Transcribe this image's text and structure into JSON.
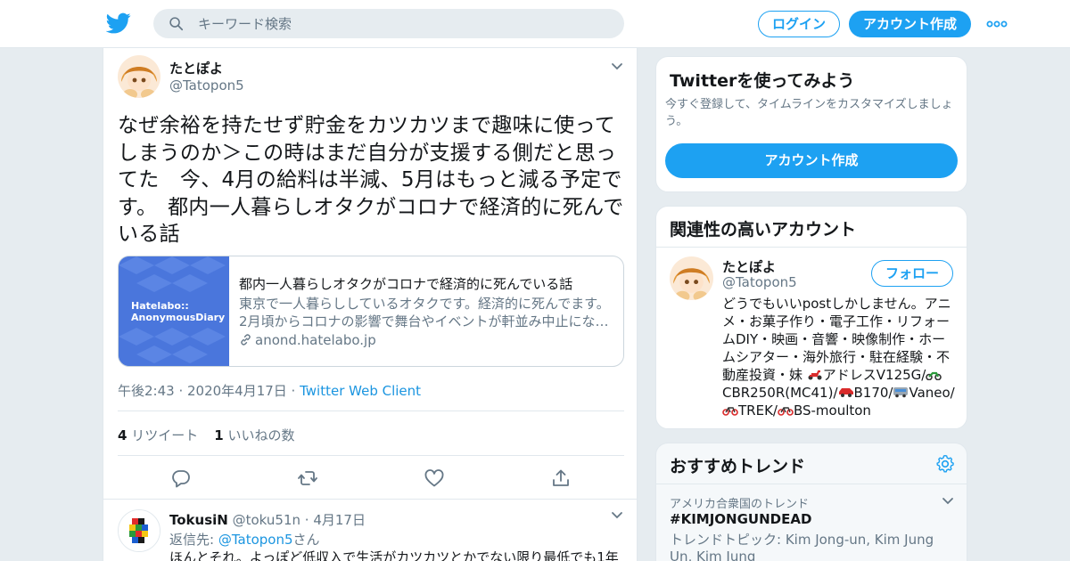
{
  "header": {
    "search_placeholder": "キーワード検索",
    "login_label": "ログイン",
    "signup_label": "アカウント作成"
  },
  "tweet": {
    "name": "たとぽよ",
    "handle": "@Tatopon5",
    "text": "なぜ余裕を持たせず貯金をカツカツまで趣味に使ってしまうのか＞この時はまだ自分が支援する側だと思ってた　今、4月の給料は半減、5月はもっと減る予定です。　都内一人暮らしオタクがコロナで経済的に死んでいる話",
    "card": {
      "image_text_1": "Hatelabo::",
      "image_text_2": "AnonymousDiary",
      "title": "都内一人暮らしオタクがコロナで経済的に死んでいる話",
      "desc_line1": "東京で一人暮らししているオタクです。経済的に死んでます。",
      "desc_line2": "2月頃からコロナの影響で舞台やイベントが軒並み中止にな…",
      "domain": "anond.hatelabo.jp"
    },
    "meta_time": "午後2:43 · 2020年4月17日 · ",
    "meta_source": "Twitter Web Client",
    "retweet_count": "4",
    "retweet_label": "リツイート",
    "like_count": "1",
    "like_label": "いいねの数"
  },
  "reply": {
    "name": "TokusiN",
    "handle": "@toku51n",
    "date": "· 4月17日",
    "replying_to_prefix": "返信先: ",
    "replying_to_handle": "@Tatopon5",
    "replying_to_suffix": "さん",
    "text": "ほんとそれ。よっぽど低収入で生活がカツカツとかでない限り最低でも1年"
  },
  "sidebar": {
    "signup_box": {
      "title": "Twitterを使ってみよう",
      "subtitle": "今すぐ登録して、タイムラインをカスタマイズしましょう。",
      "button_label": "アカウント作成"
    },
    "related": {
      "title": "関連性の高いアカウント",
      "name": "たとぽよ",
      "handle": "@Tatopon5",
      "follow_label": "フォロー",
      "bio_1": "どうでもいいpostしかしません。アニメ・お菓子作り・電子工作・リフォームDIY・映画・音響・映像制作・ホームシアター・海外旅行・駐在経験・不動産投資・妹 ",
      "bio_2": "アドレスV125G/",
      "bio_3": "CBR250R(MC41)/",
      "bio_4": "B170/",
      "bio_5": "Vaneo/",
      "bio_6": "TREK/",
      "bio_7": "BS-moulton"
    },
    "trends": {
      "title": "おすすめトレンド",
      "category": "アメリカ合衆国のトレンド",
      "name": "#KIMJONGUNDEAD",
      "topics": "トレンドトピック: Kim Jong-un, Kim Jung Un, Kim Jung"
    }
  },
  "colors": {
    "accent": "#1da1f2",
    "link": "#1b95e0",
    "secondary_text": "#657786",
    "border": "#e1e8ed",
    "page_bg": "#e6ecf0"
  },
  "icons": [
    "twitter-bird-icon",
    "search-icon",
    "more-icon",
    "chevron-down-icon",
    "link-icon",
    "reply-icon",
    "retweet-icon",
    "like-icon",
    "share-icon",
    "settings-icon",
    "scooter-emoji-icon",
    "motorcycle-emoji-icon",
    "car-emoji-icon",
    "minibus-emoji-icon",
    "bicycle-emoji-icon"
  ]
}
